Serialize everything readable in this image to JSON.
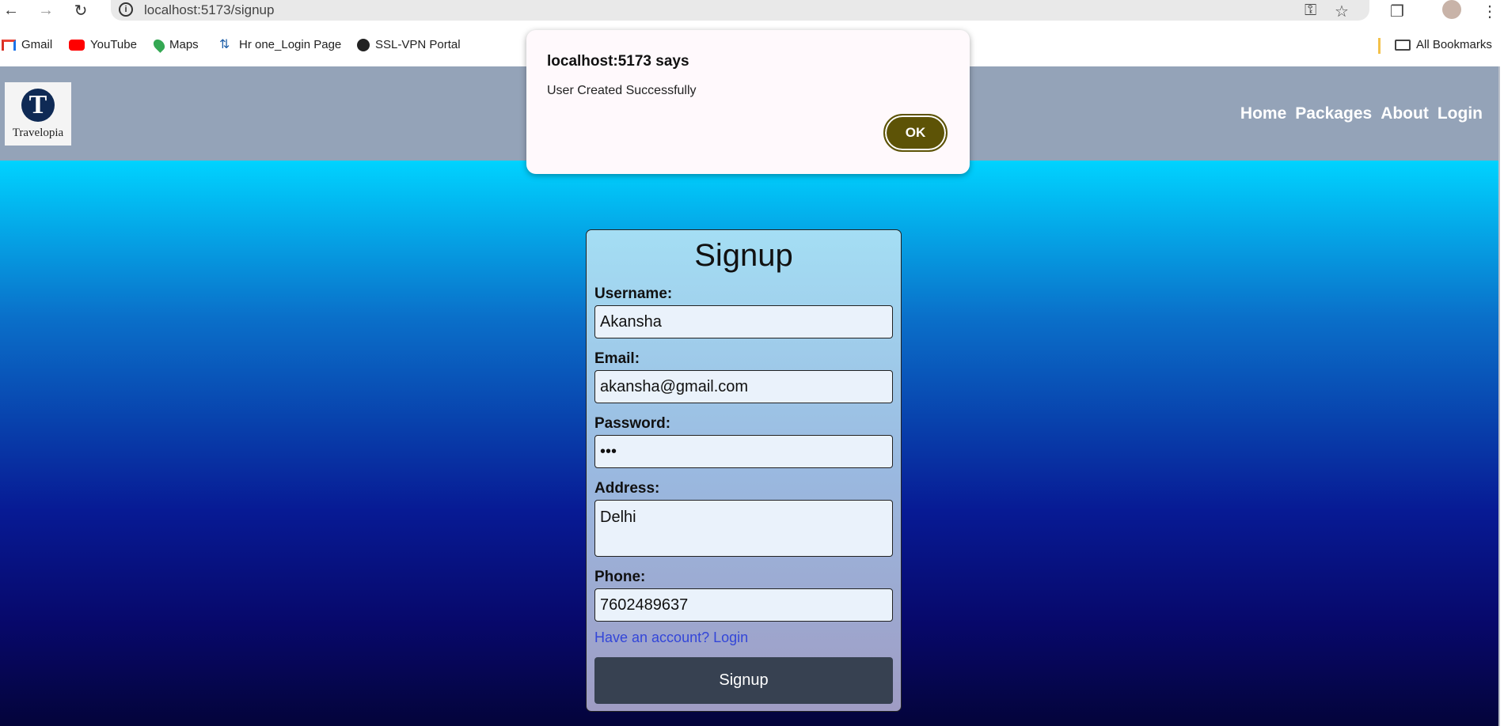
{
  "browser": {
    "url": "localhost:5173/signup",
    "bookmarks": [
      {
        "label": "Gmail",
        "icon": "gmail-icon"
      },
      {
        "label": "YouTube",
        "icon": "youtube-icon"
      },
      {
        "label": "Maps",
        "icon": "maps-icon"
      },
      {
        "label": "Hr one_Login Page",
        "icon": "hrone-icon"
      },
      {
        "label": "SSL-VPN Portal",
        "icon": "globe-icon"
      }
    ],
    "all_bookmarks": "All Bookmarks"
  },
  "header": {
    "logo_text": "Travelopia",
    "logo_letter": "T",
    "nav": [
      "Home",
      "Packages",
      "About",
      "Login"
    ]
  },
  "form": {
    "title": "Signup",
    "fields": [
      {
        "label": "Username:",
        "value": "Akansha"
      },
      {
        "label": "Email:",
        "value": "akansha@gmail.com"
      },
      {
        "label": "Password:",
        "value": "•••"
      },
      {
        "label": "Address:",
        "value": "Delhi"
      },
      {
        "label": "Phone:",
        "value": "7602489637"
      }
    ],
    "login_link": "Have an account? Login",
    "submit": "Signup"
  },
  "dialog": {
    "title": "localhost:5173 says",
    "message": "User Created Successfully",
    "ok": "OK"
  },
  "colors": {
    "header_bg": "#94a3b8",
    "button_bg": "#374151",
    "ok_bg": "#5d5306",
    "link": "#3346d8"
  }
}
